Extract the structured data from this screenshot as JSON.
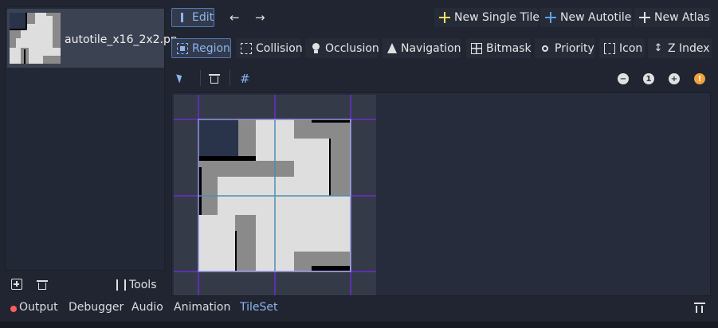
{
  "tile_list": {
    "items": [
      {
        "label": "autotile_x16_2x2.pn"
      }
    ]
  },
  "left_toolbar": {
    "tools_label": "Tools"
  },
  "toolbar": {
    "edit_label": "Edit",
    "new_single_tile": "New Single Tile",
    "new_autotile": "New Autotile",
    "new_atlas": "New Atlas"
  },
  "modes": [
    {
      "label": "Region"
    },
    {
      "label": "Collision"
    },
    {
      "label": "Occlusion"
    },
    {
      "label": "Navigation"
    },
    {
      "label": "Bitmask"
    },
    {
      "label": "Priority"
    },
    {
      "label": "Icon"
    },
    {
      "label": "Z Index"
    }
  ],
  "zoom": {
    "reset_label": "1"
  },
  "bottom_tabs": [
    {
      "label": "Output"
    },
    {
      "label": "Debugger"
    },
    {
      "label": "Audio"
    },
    {
      "label": "Animation"
    },
    {
      "label": "TileSet"
    }
  ],
  "colors": {
    "accent": "#8fb4ef",
    "add_icon": "#f5e063",
    "autotile_icon": "#5f9ef6",
    "warning": "#f2a23a",
    "output_dot": "#ff5d5d",
    "region_line": "#6a2cd0",
    "grid_line": "#3fbfa0"
  }
}
